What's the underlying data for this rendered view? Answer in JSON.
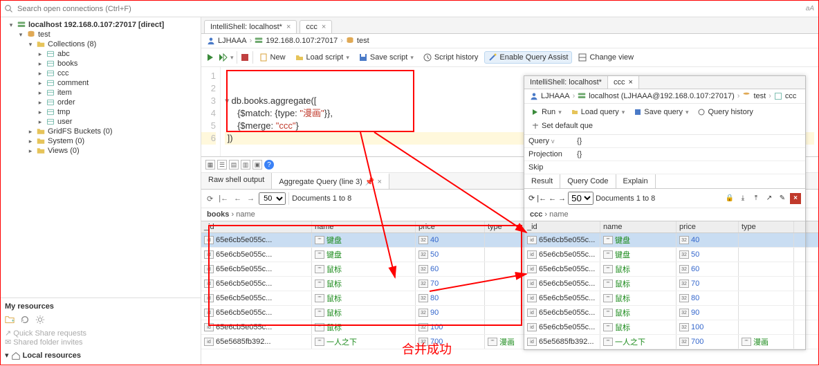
{
  "search_placeholder": "Search open connections (Ctrl+F)",
  "aA": "aA",
  "conn_host": "localhost 192.168.0.107:27017 [direct]",
  "db_name": "test",
  "collections_label": "Collections (8)",
  "collections": [
    "abc",
    "books",
    "ccc",
    "comment",
    "item",
    "order",
    "tmp",
    "user"
  ],
  "gridfs": "GridFS Buckets (0)",
  "system": "System (0)",
  "views": "Views (0)",
  "myres_title": "My resources",
  "quickshare": "Quick Share requests",
  "sharedfolder": "Shared folder invites",
  "localres": "Local resources",
  "tabs": [
    "IntelliShell: localhost*",
    "ccc"
  ],
  "crumb_user": "LJHAAA",
  "crumb_host": "192.168.0.107:27017",
  "crumb_db": "test",
  "tb": {
    "new": "New",
    "load": "Load script",
    "save": "Save script",
    "hist": "Script history",
    "qassist": "Enable Query Assist",
    "view": "Change view"
  },
  "editor_lines": [
    "1",
    "2",
    "3",
    "4",
    "5",
    "6"
  ],
  "code_plain": "db.books.aggregate([\n    {$match: {type: \"漫画\"}},\n    {$merge: \"ccc\"}\n])",
  "code3a": "db.books.aggregate([",
  "code4a": "    {$match: {type: ",
  "code4b": "\"漫画\"",
  "code4c": "}},",
  "code5a": "    {$merge: ",
  "code5b": "\"ccc\"",
  "code5c": "}",
  "code6": "])",
  "subtab_raw": "Raw shell output",
  "subtab_agg": "Aggregate Query (line 3)",
  "page_size": "50",
  "doc_count": "Documents 1 to 8",
  "bc_books": "books",
  "bc_name": "name",
  "cols": [
    "_id",
    "name",
    "price",
    "type"
  ],
  "rows": [
    {
      "id": "65e6cb5e055c...",
      "name": "键盘",
      "price": "40",
      "type": ""
    },
    {
      "id": "65e6cb5e055c...",
      "name": "键盘",
      "price": "50",
      "type": ""
    },
    {
      "id": "65e6cb5e055c...",
      "name": "鼠标",
      "price": "60",
      "type": ""
    },
    {
      "id": "65e6cb5e055c...",
      "name": "鼠标",
      "price": "70",
      "type": ""
    },
    {
      "id": "65e6cb5e055c...",
      "name": "鼠标",
      "price": "80",
      "type": ""
    },
    {
      "id": "65e6cb5e055c...",
      "name": "鼠标",
      "price": "90",
      "type": ""
    },
    {
      "id": "65e6cb5e055c...",
      "name": "鼠标",
      "price": "100",
      "type": ""
    },
    {
      "id": "65e5685fb392...",
      "name": "一人之下",
      "price": "700",
      "type": "漫画"
    }
  ],
  "overlay": {
    "tabs": [
      "IntelliShell: localhost*",
      "ccc"
    ],
    "crumb_user": "LJHAAA",
    "crumb_host": "localhost (LJHAAA@192.168.0.107:27017)",
    "crumb_db": "test",
    "crumb_coll": "ccc",
    "tb": {
      "run": "Run",
      "load": "Load query",
      "save": "Save query",
      "hist": "Query history",
      "setdef": "Set default que"
    },
    "q_label": "Query",
    "q_val": "{}",
    "p_label": "Projection",
    "p_val": "{}",
    "s_label": "Skip",
    "s_val": "",
    "subtabs": [
      "Result",
      "Query Code",
      "Explain"
    ],
    "page_size": "50",
    "doc_count": "Documents 1 to 8",
    "bc": "ccc",
    "bc_sub": "name",
    "cols": [
      "_id",
      "name",
      "price",
      "type"
    ],
    "rows": [
      {
        "id": "65e6cb5e055c...",
        "name": "键盘",
        "price": "40",
        "type": ""
      },
      {
        "id": "65e6cb5e055c...",
        "name": "键盘",
        "price": "50",
        "type": ""
      },
      {
        "id": "65e6cb5e055c...",
        "name": "鼠标",
        "price": "60",
        "type": ""
      },
      {
        "id": "65e6cb5e055c...",
        "name": "鼠标",
        "price": "70",
        "type": ""
      },
      {
        "id": "65e6cb5e055c...",
        "name": "鼠标",
        "price": "80",
        "type": ""
      },
      {
        "id": "65e6cb5e055c...",
        "name": "鼠标",
        "price": "90",
        "type": ""
      },
      {
        "id": "65e6cb5e055c...",
        "name": "鼠标",
        "price": "100",
        "type": ""
      },
      {
        "id": "65e5685fb392...",
        "name": "一人之下",
        "price": "700",
        "type": "漫画"
      }
    ]
  },
  "annot_text": "合并成功"
}
